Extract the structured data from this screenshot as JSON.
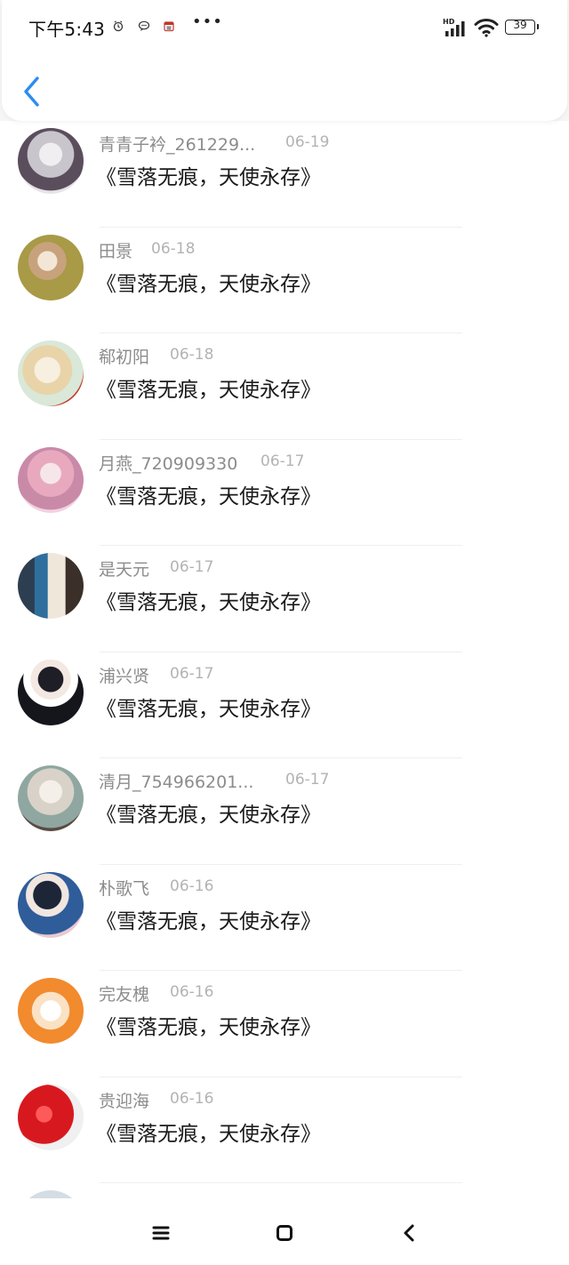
{
  "status_bar": {
    "time": "下午5:43",
    "icons": [
      "alarm-icon",
      "message-icon",
      "calendar-icon",
      "more-dots-icon",
      "hd-signal-icon",
      "wifi-icon",
      "battery-icon"
    ],
    "hd_label": "HD",
    "battery": "39"
  },
  "header": {
    "back_icon": "chevron-left-icon"
  },
  "list": {
    "items": [
      {
        "name": "青青子衿_261229...",
        "date": "06-19",
        "title": "《雪落无痕，天使永存》"
      },
      {
        "name": "田景",
        "date": "06-18",
        "title": "《雪落无痕，天使永存》"
      },
      {
        "name": "郗初阳",
        "date": "06-18",
        "title": "《雪落无痕，天使永存》"
      },
      {
        "name": "月燕_720909330",
        "date": "06-17",
        "title": "《雪落无痕，天使永存》"
      },
      {
        "name": "是天元",
        "date": "06-17",
        "title": "《雪落无痕，天使永存》"
      },
      {
        "name": "浦兴贤",
        "date": "06-17",
        "title": "《雪落无痕，天使永存》"
      },
      {
        "name": "清月_754966201...",
        "date": "06-17",
        "title": "《雪落无痕，天使永存》"
      },
      {
        "name": "朴歌飞",
        "date": "06-16",
        "title": "《雪落无痕，天使永存》"
      },
      {
        "name": "完友槐",
        "date": "06-16",
        "title": "《雪落无痕，天使永存》"
      },
      {
        "name": "贵迎海",
        "date": "06-16",
        "title": "《雪落无痕，天使永存》"
      }
    ]
  },
  "navbar": {
    "icons": [
      "menu-icon",
      "home-square-icon",
      "back-chevron-icon"
    ]
  },
  "colors": {
    "accent": "#2a8ef0",
    "name": "#8c8c8c",
    "date": "#b3b3b3",
    "title": "#1a1a1a"
  }
}
